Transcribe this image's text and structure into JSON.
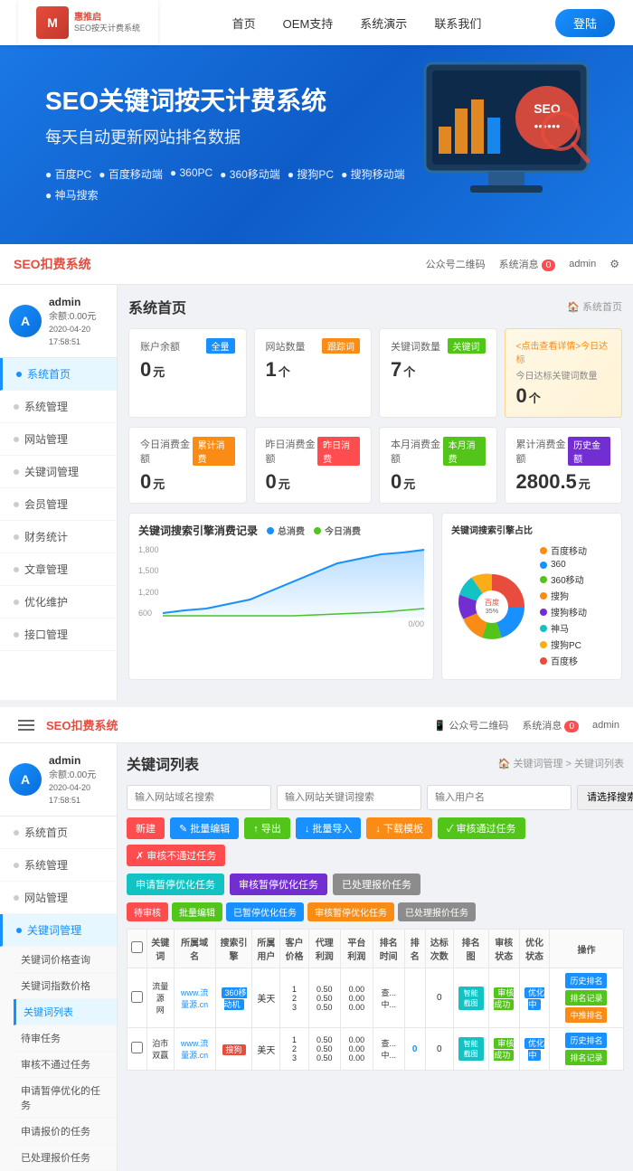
{
  "topNav": {
    "logoText": "M",
    "logoSubText": "SEO按天计费系统",
    "menuItems": [
      "首页",
      "OEM支持",
      "系统演示",
      "联系我们"
    ],
    "loginLabel": "登陆"
  },
  "hero": {
    "title": "SEO关键词按天计费系统",
    "subtitle": "每天自动更新网站排名数据",
    "bullets": [
      "百度PC",
      "百度移动端",
      "360PC",
      "360移动端",
      "搜狗PC",
      "搜狗移动端",
      "神马搜索"
    ]
  },
  "dashboard1": {
    "title": "SEO扣费系统",
    "headerRight": {
      "qrLabel": "公众号二维码",
      "noticeLabel": "系统消息",
      "noticeBadge": "0",
      "adminLabel": "admin"
    },
    "user": {
      "name": "admin",
      "balance": "余额:0.00元",
      "date": "2020-04-20 17:58:51"
    },
    "sidebarItems": [
      "系统首页",
      "系统管理",
      "网站管理",
      "关键词管理",
      "会员管理",
      "财务统计",
      "文章管理",
      "优化维护",
      "接口管理"
    ],
    "pageTitle": "系统首页",
    "breadcrumb": "系统首页",
    "stats1": [
      {
        "label": "账户余额",
        "tag": "全量",
        "tagColor": "blue",
        "value": "0",
        "unit": "元"
      },
      {
        "label": "网站数量",
        "tag": "跟踪词",
        "tagColor": "orange",
        "value": "1",
        "unit": "个"
      },
      {
        "label": "关键词数量",
        "tag": "关键词",
        "tagColor": "green",
        "value": "7",
        "unit": "个"
      }
    ],
    "statsSpecial": {
      "label": "<点击查看详情>今日达标",
      "sublabel": "今日达标关键词数量",
      "value": "0",
      "unit": "个"
    },
    "stats2": [
      {
        "label": "今日消费金额",
        "tag": "累计消费",
        "tagColor": "orange",
        "value": "0",
        "unit": "元"
      },
      {
        "label": "昨日消费金额",
        "tag": "昨日消费",
        "tagColor": "red",
        "value": "0",
        "unit": "元"
      },
      {
        "label": "本月消费金额",
        "tag": "本月消费",
        "tagColor": "green",
        "value": "0",
        "unit": "元"
      },
      {
        "label": "累计消费金额",
        "tag": "历史金额",
        "tagColor": "purple",
        "value": "2800.5",
        "unit": "元"
      }
    ],
    "lineChart": {
      "title": "关键词搜索引擎消费记录",
      "legend": [
        "总消费",
        "今日消费"
      ],
      "colors": [
        "#1890ff",
        "#52c41a"
      ],
      "yLabels": [
        "1,800",
        "1,500",
        "1,200",
        "600"
      ],
      "xLabels": [
        "0/00"
      ]
    },
    "pieChart": {
      "title": "关键词搜索引擎占比",
      "items": [
        {
          "label": "百度",
          "color": "#e74c3c",
          "percent": 35
        },
        {
          "label": "360",
          "color": "#1890ff",
          "percent": 20
        },
        {
          "label": "360移动",
          "color": "#52c41a",
          "percent": 10
        },
        {
          "label": "搜狗",
          "color": "#fa8c16",
          "percent": 10
        },
        {
          "label": "搜狗移动",
          "color": "#722ed1",
          "percent": 10
        },
        {
          "label": "神马",
          "color": "#13c2c2",
          "percent": 5
        },
        {
          "label": "搜狗PC",
          "color": "#f5222d",
          "percent": 5
        },
        {
          "label": "百度移",
          "color": "#faad14",
          "percent": 5
        }
      ]
    }
  },
  "dashboard2": {
    "title": "SEO扣费系统",
    "user": {
      "name": "admin",
      "balance": "余额:0.00元",
      "date": "2020-04-20 17:58:51"
    },
    "pageTitle": "关键词列表",
    "breadcrumb1": "关键词管理",
    "breadcrumb2": "关键词列表",
    "sidebarItems": [
      "系统首页",
      "系统管理",
      "网站管理",
      "关键词管理"
    ],
    "subItems": [
      "关键词价格查询",
      "关键词指数价格",
      "关键词列表",
      "待审任务",
      "审核不通过任务",
      "申请暂停优化的任务",
      "申请报价的任务",
      "已处理报价任务"
    ],
    "searchPlaceholders": [
      "输入网站域名搜索",
      "输入网站关键词搜索",
      "输入用户名"
    ],
    "selectPlaceholder": "请选择搜索引擎",
    "toolbarBtns": [
      "新建",
      "批量编辑",
      "导出",
      "批量导入",
      "下载模板",
      "审核通过任务",
      "审核不通过任务",
      "申请暂停优化化任务",
      "审核暂停优化任务",
      "已处理报价任务"
    ],
    "filterBtns": [
      "待审核",
      "批量编辑",
      "已暂停优化任务",
      "审核暂停优化任务",
      "已处理报价任务"
    ],
    "tableHeaders": [
      "",
      "关键词",
      "所属域名",
      "搜索引擎",
      "所属用户",
      "客户价格",
      "代理利润",
      "平台利润",
      "排名时间",
      "排名",
      "达标次数",
      "排名图",
      "审核状态",
      "优化状态",
      "操作"
    ],
    "tableRows": [
      {
        "keyword": "流量源网",
        "domain": "www.流量源.cn",
        "engine": "360移动机",
        "user": "美天",
        "clientPrice": "1\n2\n3",
        "agentProfit": "0.50\n0.50\n0.50",
        "platformProfit": "0.00\n0.00\n0.00",
        "rankTime": "查...\n中...",
        "rank": "",
        "reachCount": "0",
        "rankChart": "智能截图",
        "auditStatus": "审核成功",
        "optStatus": "优化中",
        "ops": [
          "历史排名",
          "排名记录",
          "中推排名"
        ]
      },
      {
        "keyword": "泊市\n双赢",
        "domain": "www.流量源.cn",
        "engine": "搜狗",
        "user": "美天",
        "clientPrice": "1\n2\n3",
        "agentProfit": "0.50\n0.50\n0.50",
        "platformProfit": "0.00\n0.00\n0.00",
        "rankTime": "查...\n中...",
        "rank": "0",
        "reachCount": "0",
        "rankChart": "智能截图",
        "auditStatus": "审核成功",
        "optStatus": "优化中",
        "ops": [
          "历史排名",
          "排名记录"
        ]
      }
    ]
  }
}
